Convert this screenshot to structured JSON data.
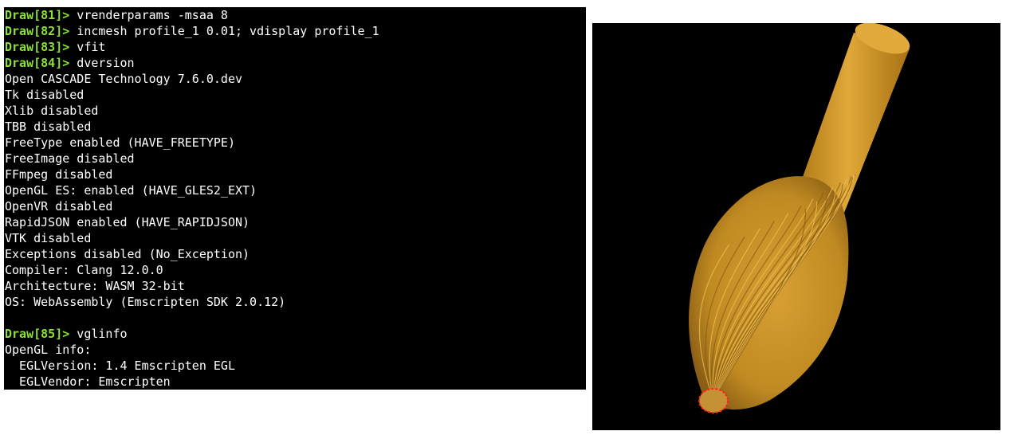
{
  "terminal": {
    "lines": [
      {
        "prompt": "Draw[81]>",
        "text": " vrenderparams -msaa 8"
      },
      {
        "prompt": "Draw[82]>",
        "text": " incmesh profile_1 0.01; vdisplay profile_1"
      },
      {
        "prompt": "Draw[83]>",
        "text": " vfit"
      },
      {
        "prompt": "Draw[84]>",
        "text": " dversion"
      },
      {
        "prompt": "",
        "text": "Open CASCADE Technology 7.6.0.dev"
      },
      {
        "prompt": "",
        "text": "Tk disabled"
      },
      {
        "prompt": "",
        "text": "Xlib disabled"
      },
      {
        "prompt": "",
        "text": "TBB disabled"
      },
      {
        "prompt": "",
        "text": "FreeType enabled (HAVE_FREETYPE)"
      },
      {
        "prompt": "",
        "text": "FreeImage disabled"
      },
      {
        "prompt": "",
        "text": "FFmpeg disabled"
      },
      {
        "prompt": "",
        "text": "OpenGL ES: enabled (HAVE_GLES2_EXT)"
      },
      {
        "prompt": "",
        "text": "OpenVR disabled"
      },
      {
        "prompt": "",
        "text": "RapidJSON enabled (HAVE_RAPIDJSON)"
      },
      {
        "prompt": "",
        "text": "VTK disabled"
      },
      {
        "prompt": "",
        "text": "Exceptions disabled (No_Exception)"
      },
      {
        "prompt": "",
        "text": "Compiler: Clang 12.0.0"
      },
      {
        "prompt": "",
        "text": "Architecture: WASM 32-bit"
      },
      {
        "prompt": "",
        "text": "OS: WebAssembly (Emscripten SDK 2.0.12)"
      },
      {
        "prompt": "",
        "text": ""
      },
      {
        "prompt": "Draw[85]>",
        "text": " vglinfo"
      },
      {
        "prompt": "",
        "text": "OpenGL info:"
      },
      {
        "prompt": "",
        "text": "  EGLVersion: 1.4 Emscripten EGL"
      },
      {
        "prompt": "",
        "text": "  EGLVendor: Emscripten"
      }
    ]
  },
  "viewer": {
    "model_name": "profile_1",
    "colors": {
      "background": "#000000",
      "shape": "#d49a2a",
      "shape_dark": "#7a5210",
      "shape_light": "#f0c050",
      "highlight_edge": "#ff2020"
    }
  }
}
